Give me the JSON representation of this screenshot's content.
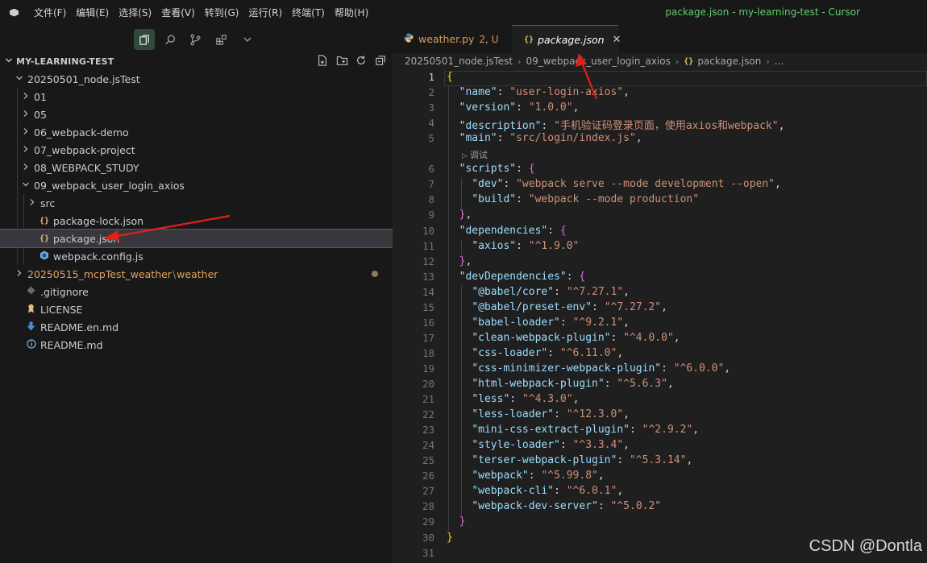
{
  "titlebar": {
    "menus": [
      "文件(F)",
      "编辑(E)",
      "选择(S)",
      "查看(V)",
      "转到(G)",
      "运行(R)",
      "终端(T)",
      "帮助(H)"
    ],
    "window_title": "package.json - my-learning-test - Cursor"
  },
  "activity": {
    "icons": [
      "files-icon",
      "search-icon",
      "source-control-icon",
      "extensions-icon",
      "chevron-down-icon"
    ]
  },
  "explorer": {
    "title": "MY-LEARNING-TEST",
    "header_icons": [
      "new-file-icon",
      "new-folder-icon",
      "refresh-icon",
      "collapse-all-icon"
    ],
    "items": [
      {
        "label": "20250501_node.jsTest",
        "type": "folder",
        "expanded": true
      },
      {
        "label": "01",
        "type": "folder",
        "expanded": false
      },
      {
        "label": "05",
        "type": "folder",
        "expanded": false
      },
      {
        "label": "06_webpack-demo",
        "type": "folder",
        "expanded": false
      },
      {
        "label": "07_webpack-project",
        "type": "folder",
        "expanded": false
      },
      {
        "label": "08_WEBPACK_STUDY",
        "type": "folder",
        "expanded": false
      },
      {
        "label": "09_webpack_user_login_axios",
        "type": "folder",
        "expanded": true
      },
      {
        "label": "src",
        "type": "folder",
        "expanded": false
      },
      {
        "label": "package-lock.json",
        "type": "json"
      },
      {
        "label": "package.json",
        "type": "json",
        "selected": true
      },
      {
        "label": "webpack.config.js",
        "type": "webpack"
      },
      {
        "label": "20250515_mcpTest_weather",
        "suffix": "weather",
        "type": "folder",
        "expanded": false,
        "modified": true
      },
      {
        "label": ".gitignore",
        "type": "git"
      },
      {
        "label": "LICENSE",
        "type": "license"
      },
      {
        "label": "README.en.md",
        "type": "markdown"
      },
      {
        "label": "README.md",
        "type": "info"
      }
    ]
  },
  "tabs": [
    {
      "label": "weather.py",
      "status": "2, U",
      "active": false
    },
    {
      "label": "package.json",
      "active": true
    }
  ],
  "breadcrumb": [
    "20250501_node.jsTest",
    "09_webpack_user_login_axios",
    "package.json",
    "..."
  ],
  "editor": {
    "codelens": "调试",
    "line_numbers": [
      "1",
      "2",
      "3",
      "4",
      "5",
      "6",
      "7",
      "8",
      "9",
      "10",
      "11",
      "12",
      "13",
      "14",
      "15",
      "16",
      "17",
      "18",
      "19",
      "20",
      "21",
      "22",
      "23",
      "24",
      "25",
      "26",
      "27",
      "28",
      "29",
      "30",
      "31"
    ],
    "lines": [
      {
        "ln": "1",
        "parts": [
          [
            "b1",
            "{"
          ]
        ]
      },
      {
        "ln": "2",
        "parts": [
          [
            "p",
            "  "
          ],
          [
            "k",
            "\"name\""
          ],
          [
            "p",
            ": "
          ],
          [
            "s",
            "\"user-login-axios\""
          ],
          [
            "p",
            ","
          ]
        ]
      },
      {
        "ln": "3",
        "parts": [
          [
            "p",
            "  "
          ],
          [
            "k",
            "\"version\""
          ],
          [
            "p",
            ": "
          ],
          [
            "s",
            "\"1.0.0\""
          ],
          [
            "p",
            ","
          ]
        ]
      },
      {
        "ln": "4",
        "parts": [
          [
            "p",
            "  "
          ],
          [
            "k",
            "\"description\""
          ],
          [
            "p",
            ": "
          ],
          [
            "s",
            "\"手机验证码登录页面，使用axios和webpack\""
          ],
          [
            "p",
            ","
          ]
        ]
      },
      {
        "ln": "5",
        "parts": [
          [
            "p",
            "  "
          ],
          [
            "k",
            "\"main\""
          ],
          [
            "p",
            ": "
          ],
          [
            "s",
            "\"src/login/index.js\""
          ],
          [
            "p",
            ","
          ]
        ]
      },
      {
        "ln": "6",
        "parts": [
          [
            "p",
            "  "
          ],
          [
            "k",
            "\"scripts\""
          ],
          [
            "p",
            ": "
          ],
          [
            "b2",
            "{"
          ]
        ]
      },
      {
        "ln": "7",
        "parts": [
          [
            "p",
            "    "
          ],
          [
            "k",
            "\"dev\""
          ],
          [
            "p",
            ": "
          ],
          [
            "s",
            "\"webpack serve --mode development --open\""
          ],
          [
            "p",
            ","
          ]
        ]
      },
      {
        "ln": "8",
        "parts": [
          [
            "p",
            "    "
          ],
          [
            "k",
            "\"build\""
          ],
          [
            "p",
            ": "
          ],
          [
            "s",
            "\"webpack --mode production\""
          ]
        ]
      },
      {
        "ln": "9",
        "parts": [
          [
            "p",
            "  "
          ],
          [
            "b2",
            "}"
          ],
          [
            "p",
            ","
          ]
        ]
      },
      {
        "ln": "10",
        "parts": [
          [
            "p",
            "  "
          ],
          [
            "k",
            "\"dependencies\""
          ],
          [
            "p",
            ": "
          ],
          [
            "b2",
            "{"
          ]
        ]
      },
      {
        "ln": "11",
        "parts": [
          [
            "p",
            "    "
          ],
          [
            "k",
            "\"axios\""
          ],
          [
            "p",
            ": "
          ],
          [
            "s",
            "\"^1.9.0\""
          ]
        ]
      },
      {
        "ln": "12",
        "parts": [
          [
            "p",
            "  "
          ],
          [
            "b2",
            "}"
          ],
          [
            "p",
            ","
          ]
        ]
      },
      {
        "ln": "13",
        "parts": [
          [
            "p",
            "  "
          ],
          [
            "k",
            "\"devDependencies\""
          ],
          [
            "p",
            ": "
          ],
          [
            "b2",
            "{"
          ]
        ]
      },
      {
        "ln": "14",
        "parts": [
          [
            "p",
            "    "
          ],
          [
            "k",
            "\"@babel/core\""
          ],
          [
            "p",
            ": "
          ],
          [
            "s",
            "\"^7.27.1\""
          ],
          [
            "p",
            ","
          ]
        ]
      },
      {
        "ln": "15",
        "parts": [
          [
            "p",
            "    "
          ],
          [
            "k",
            "\"@babel/preset-env\""
          ],
          [
            "p",
            ": "
          ],
          [
            "s",
            "\"^7.27.2\""
          ],
          [
            "p",
            ","
          ]
        ]
      },
      {
        "ln": "16",
        "parts": [
          [
            "p",
            "    "
          ],
          [
            "k",
            "\"babel-loader\""
          ],
          [
            "p",
            ": "
          ],
          [
            "s",
            "\"^9.2.1\""
          ],
          [
            "p",
            ","
          ]
        ]
      },
      {
        "ln": "17",
        "parts": [
          [
            "p",
            "    "
          ],
          [
            "k",
            "\"clean-webpack-plugin\""
          ],
          [
            "p",
            ": "
          ],
          [
            "s",
            "\"^4.0.0\""
          ],
          [
            "p",
            ","
          ]
        ]
      },
      {
        "ln": "18",
        "parts": [
          [
            "p",
            "    "
          ],
          [
            "k",
            "\"css-loader\""
          ],
          [
            "p",
            ": "
          ],
          [
            "s",
            "\"^6.11.0\""
          ],
          [
            "p",
            ","
          ]
        ]
      },
      {
        "ln": "19",
        "parts": [
          [
            "p",
            "    "
          ],
          [
            "k",
            "\"css-minimizer-webpack-plugin\""
          ],
          [
            "p",
            ": "
          ],
          [
            "s",
            "\"^6.0.0\""
          ],
          [
            "p",
            ","
          ]
        ]
      },
      {
        "ln": "20",
        "parts": [
          [
            "p",
            "    "
          ],
          [
            "k",
            "\"html-webpack-plugin\""
          ],
          [
            "p",
            ": "
          ],
          [
            "s",
            "\"^5.6.3\""
          ],
          [
            "p",
            ","
          ]
        ]
      },
      {
        "ln": "21",
        "parts": [
          [
            "p",
            "    "
          ],
          [
            "k",
            "\"less\""
          ],
          [
            "p",
            ": "
          ],
          [
            "s",
            "\"^4.3.0\""
          ],
          [
            "p",
            ","
          ]
        ]
      },
      {
        "ln": "22",
        "parts": [
          [
            "p",
            "    "
          ],
          [
            "k",
            "\"less-loader\""
          ],
          [
            "p",
            ": "
          ],
          [
            "s",
            "\"^12.3.0\""
          ],
          [
            "p",
            ","
          ]
        ]
      },
      {
        "ln": "23",
        "parts": [
          [
            "p",
            "    "
          ],
          [
            "k",
            "\"mini-css-extract-plugin\""
          ],
          [
            "p",
            ": "
          ],
          [
            "s",
            "\"^2.9.2\""
          ],
          [
            "p",
            ","
          ]
        ]
      },
      {
        "ln": "24",
        "parts": [
          [
            "p",
            "    "
          ],
          [
            "k",
            "\"style-loader\""
          ],
          [
            "p",
            ": "
          ],
          [
            "s",
            "\"^3.3.4\""
          ],
          [
            "p",
            ","
          ]
        ]
      },
      {
        "ln": "25",
        "parts": [
          [
            "p",
            "    "
          ],
          [
            "k",
            "\"terser-webpack-plugin\""
          ],
          [
            "p",
            ": "
          ],
          [
            "s",
            "\"^5.3.14\""
          ],
          [
            "p",
            ","
          ]
        ]
      },
      {
        "ln": "26",
        "parts": [
          [
            "p",
            "    "
          ],
          [
            "k",
            "\"webpack\""
          ],
          [
            "p",
            ": "
          ],
          [
            "s",
            "\"^5.99.8\""
          ],
          [
            "p",
            ","
          ]
        ]
      },
      {
        "ln": "27",
        "parts": [
          [
            "p",
            "    "
          ],
          [
            "k",
            "\"webpack-cli\""
          ],
          [
            "p",
            ": "
          ],
          [
            "s",
            "\"^6.0.1\""
          ],
          [
            "p",
            ","
          ]
        ]
      },
      {
        "ln": "28",
        "parts": [
          [
            "p",
            "    "
          ],
          [
            "k",
            "\"webpack-dev-server\""
          ],
          [
            "p",
            ": "
          ],
          [
            "s",
            "\"^5.0.2\""
          ]
        ]
      },
      {
        "ln": "29",
        "parts": [
          [
            "p",
            "  "
          ],
          [
            "b2",
            "}"
          ]
        ]
      },
      {
        "ln": "30",
        "parts": [
          [
            "b1",
            "}"
          ]
        ]
      },
      {
        "ln": "31",
        "parts": []
      }
    ]
  },
  "watermark": "CSDN @Dontla",
  "colors": {
    "accent": "#0078d4",
    "string": "#ce9178",
    "key": "#9cdcfe",
    "annotation": "#e0201b"
  }
}
